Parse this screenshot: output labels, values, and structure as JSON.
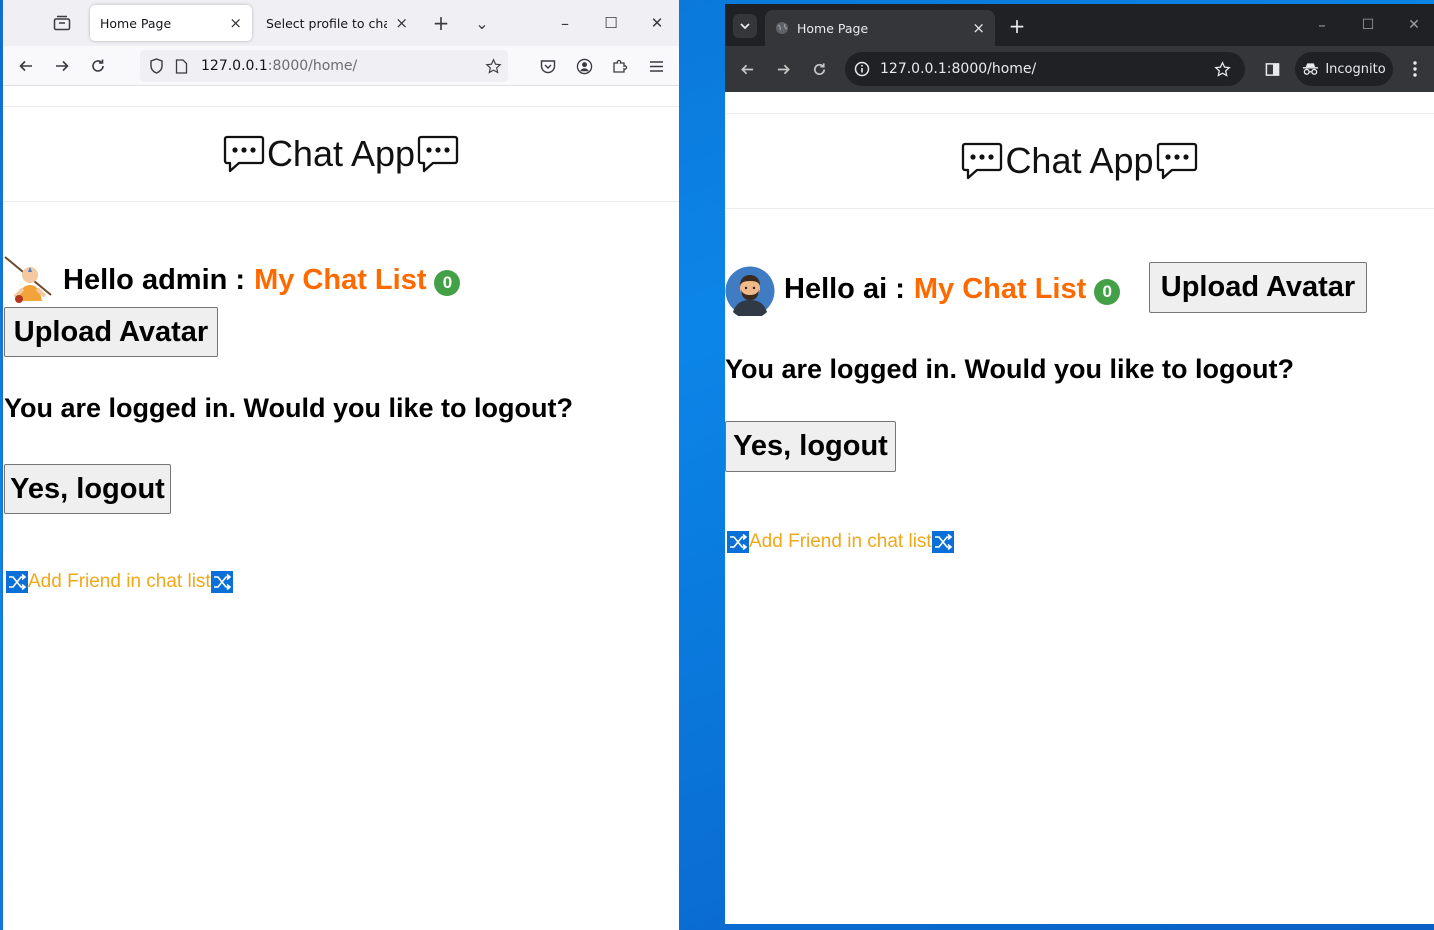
{
  "firefox": {
    "tabs": [
      {
        "title": "Home Page",
        "close": "×"
      },
      {
        "title": "Select profile to change |",
        "close": "×"
      }
    ],
    "new_tab": "+",
    "tab_list": "⌄",
    "window_controls": {
      "minimize": "–",
      "maximize": "☐",
      "close": "✕"
    },
    "url_host": "127.0.0.1",
    "url_rest": ":8000/home/",
    "icons": [
      "tab-manager-icon",
      "back-icon",
      "forward-icon",
      "reload-icon",
      "shield-icon",
      "page-icon",
      "star-icon",
      "pocket-icon",
      "account-icon",
      "extensions-icon",
      "menu-icon"
    ]
  },
  "chrome": {
    "tab": {
      "title": "Home Page",
      "close": "×"
    },
    "new_tab": "+",
    "window_controls": {
      "minimize": "–",
      "maximize": "☐",
      "close": "✕"
    },
    "url": "127.0.0.1:8000/home/",
    "incognito_label": "Incognito",
    "icons": [
      "tab-search-icon",
      "back-icon",
      "forward-icon",
      "reload-icon",
      "info-icon",
      "star-icon",
      "side-panel-icon",
      "incognito-icon",
      "kebab-menu-icon"
    ]
  },
  "app": {
    "title": "Chat App",
    "chat_list_label": "My Chat List",
    "upload_avatar": "Upload Avatar",
    "logout_question": "You are logged in. Would you like to logout?",
    "logout_button": "Yes, logout",
    "add_friend": "Add Friend in chat list"
  },
  "admin_view": {
    "hello": "Hello admin :",
    "unread_count": "0"
  },
  "ai_view": {
    "hello": "Hello ai :",
    "unread_count": "0"
  },
  "colors": {
    "chat_list": "#ff6a00",
    "badge": "#43a047",
    "add_friend": "#f0a818",
    "desktop": "#0a86e8"
  }
}
